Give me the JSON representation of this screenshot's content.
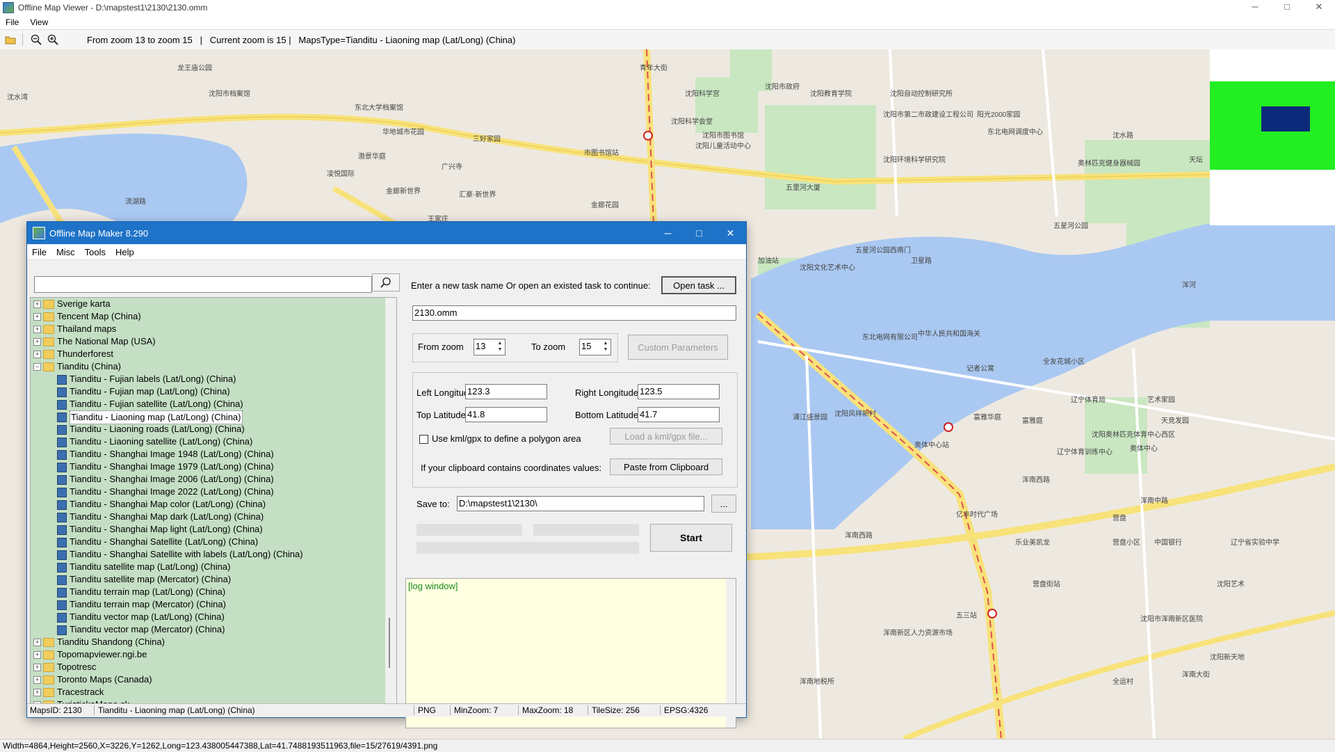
{
  "app": {
    "title": "Offline Map Viewer - D:\\mapstest1\\2130\\2130.omm",
    "menu": [
      "File",
      "View"
    ],
    "window_buttons": [
      "─",
      "□",
      "✕"
    ]
  },
  "toolbar": {
    "icons": [
      "open-folder-icon",
      "zoom-out-icon",
      "zoom-in-icon"
    ],
    "info": "From zoom 13 to zoom 15   |   Current zoom is 15 |   MapsType=Tianditu - Liaoning map (Lat/Long) (China)"
  },
  "map": {
    "labels": [
      "龙王庙公园",
      "沈水湾",
      "沈阳市档案馆",
      "东北大学档案馆",
      "华地城市花园",
      "三好家园",
      "广兴寺",
      "渤景华庭",
      "凌悦国际",
      "金廊新世界",
      "汇豪·新世界",
      "王家庄",
      "流湖路",
      "市图书馆站",
      "青年大街",
      "沈阳科学宫",
      "沈阳市图书馆",
      "沈阳科学会堂",
      "沈阳儿童活动中心",
      "沈阳市政府",
      "五里河大厦",
      "金廊花园",
      "沈阳教育学院",
      "沈阳自动控制研究所",
      "沈阳市第二市政建设工程公司",
      "阳光2000家园",
      "东北电网调度中心",
      "沈水路",
      "沈阳环境科学研究院",
      "奥林匹克健身器械园",
      "天坛",
      "五星河公园",
      "五星河公园西南门",
      "卫星路",
      "浑河",
      "加油站",
      "沈阳文化艺术中心",
      "东北电网有限公司",
      "记者公寓",
      "中华人民共和国海关",
      "全友花城小区",
      "浦江盛景园",
      "沈阳风祥新村",
      "奥体中心站",
      "富雅华庭",
      "富雅庭",
      "辽宁体育局",
      "艺术家园",
      "沈阳奥林匹克体育中心西区",
      "辽宁体育训练中心",
      "天竞发园",
      "奥体中心",
      "浑南西路",
      "营盘小区",
      "浑南西路",
      "浑南中路",
      "中国银行",
      "亿丰时代广场",
      "营盘",
      "乐业美凯龙",
      "辽宁省实验中学",
      "营盘街站",
      "五三站",
      "沈阳市浑南新区医院",
      "沈阳艺术",
      "浑南新区人力资源市场",
      "浑南地税所",
      "全运村",
      "沈阳新天地",
      "浑南大街"
    ]
  },
  "statusbar": {
    "text": "Width=4864,Height=2560,X=3226,Y=1262,Long=123.438005447388,Lat=41.7488193511963,file=15/27619/4391.png"
  },
  "dialog": {
    "title": "Offline Map Maker 8.290",
    "menu": [
      "File",
      "Misc",
      "Tools",
      "Help"
    ],
    "search": {
      "value": "",
      "placeholder": ""
    },
    "tree": [
      {
        "type": "folder",
        "expanded": false,
        "label": "Sverige karta"
      },
      {
        "type": "folder",
        "expanded": false,
        "label": "Tencent Map (China)"
      },
      {
        "type": "folder",
        "expanded": false,
        "label": "Thailand maps"
      },
      {
        "type": "folder",
        "expanded": false,
        "label": "The National Map (USA)"
      },
      {
        "type": "folder",
        "expanded": false,
        "label": "Thunderforest"
      },
      {
        "type": "folder",
        "expanded": true,
        "label": "Tianditu (China)"
      },
      {
        "type": "map",
        "label": "Tianditu - Fujian labels (Lat/Long) (China)"
      },
      {
        "type": "map",
        "label": "Tianditu - Fujian map (Lat/Long) (China)"
      },
      {
        "type": "map",
        "label": "Tianditu - Fujian satellite (Lat/Long) (China)"
      },
      {
        "type": "map",
        "label": "Tianditu - Liaoning map (Lat/Long) (China)",
        "selected": true
      },
      {
        "type": "map",
        "label": "Tianditu - Liaoning roads (Lat/Long) (China)"
      },
      {
        "type": "map",
        "label": "Tianditu - Liaoning satellite (Lat/Long) (China)"
      },
      {
        "type": "map",
        "label": "Tianditu - Shanghai Image 1948 (Lat/Long) (China)"
      },
      {
        "type": "map",
        "label": "Tianditu - Shanghai Image 1979 (Lat/Long) (China)"
      },
      {
        "type": "map",
        "label": "Tianditu - Shanghai Image 2006 (Lat/Long) (China)"
      },
      {
        "type": "map",
        "label": "Tianditu - Shanghai Image 2022 (Lat/Long) (China)"
      },
      {
        "type": "map",
        "label": "Tianditu - Shanghai Map color (Lat/Long) (China)"
      },
      {
        "type": "map",
        "label": "Tianditu - Shanghai Map dark (Lat/Long) (China)"
      },
      {
        "type": "map",
        "label": "Tianditu - Shanghai Map light (Lat/Long) (China)"
      },
      {
        "type": "map",
        "label": "Tianditu - Shanghai Satellite (Lat/Long) (China)"
      },
      {
        "type": "map",
        "label": "Tianditu - Shanghai Satellite with labels (Lat/Long) (China)"
      },
      {
        "type": "map",
        "label": "Tianditu satellite map (Lat/Long) (China)"
      },
      {
        "type": "map",
        "label": "Tianditu satellite map (Mercator) (China)"
      },
      {
        "type": "map",
        "label": "Tianditu terrain map (Lat/Long) (China)"
      },
      {
        "type": "map",
        "label": "Tianditu terrain map (Mercator) (China)"
      },
      {
        "type": "map",
        "label": "Tianditu vector map (Lat/Long) (China)"
      },
      {
        "type": "map",
        "label": "Tianditu vector map (Mercator) (China)"
      },
      {
        "type": "folder",
        "expanded": false,
        "label": "Tianditu Shandong (China)"
      },
      {
        "type": "folder",
        "expanded": false,
        "label": "Topomapviewer.ngi.be"
      },
      {
        "type": "folder",
        "expanded": false,
        "label": "Topotresc"
      },
      {
        "type": "folder",
        "expanded": false,
        "label": "Toronto Maps (Canada)"
      },
      {
        "type": "folder",
        "expanded": false,
        "label": "Tracestrack"
      },
      {
        "type": "folder",
        "expanded": false,
        "label": "TuristickaMapa.sk"
      }
    ],
    "task_prompt": "Enter a new task name Or open an existed task to continue:",
    "open_task_label": "Open task ...",
    "task_name": "2130.omm",
    "from_zoom_label": "From zoom",
    "from_zoom": "13",
    "to_zoom_label": "To zoom",
    "to_zoom": "15",
    "custom_params_label": "Custom Parameters",
    "left_lon_label": "Left Longitude",
    "left_lon": "123.3",
    "right_lon_label": "Right Longitude",
    "right_lon": "123.5",
    "top_lat_label": "Top Latitude",
    "top_lat": "41.8",
    "bottom_lat_label": "Bottom Latitude",
    "bottom_lat": "41.7",
    "kml_label": "Use kml/gpx to define a polygon area",
    "load_kml_label": "Load a kml/gpx file...",
    "clipboard_prompt": "If your clipboard contains coordinates values:",
    "paste_label": "Paste from Clipboard",
    "save_to_label": "Save to:",
    "save_to": "D:\\mapstest1\\2130\\",
    "browse_label": "...",
    "start_label": "Start",
    "log": "[log window]",
    "status": {
      "maps_id": "MapsID: 2130",
      "name": "Tianditu - Liaoning map (Lat/Long) (China)",
      "format": "PNG",
      "min_zoom": "MinZoom: 7",
      "max_zoom": "MaxZoom: 18",
      "tile_size": "TileSize: 256",
      "epsg": "EPSG:4326"
    }
  }
}
